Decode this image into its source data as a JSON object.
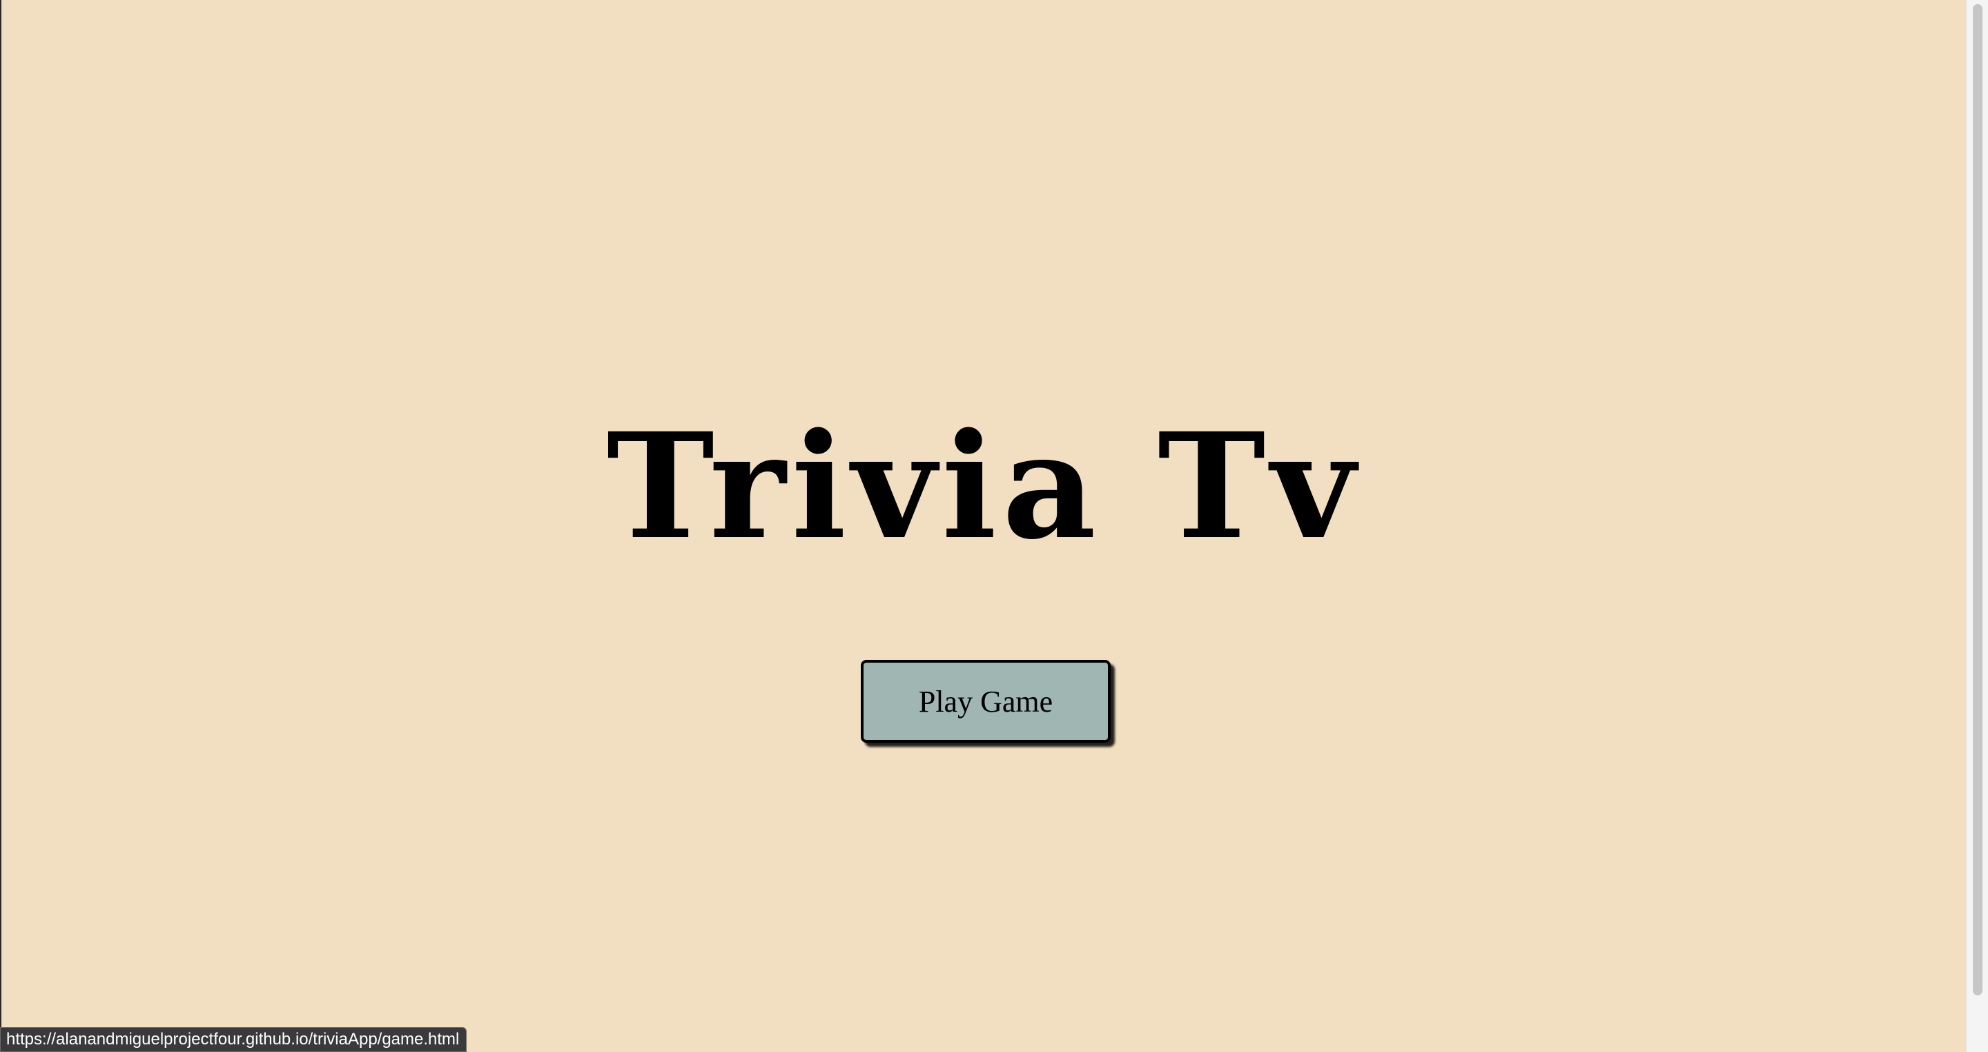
{
  "page": {
    "title": "Trivia Tv",
    "play_button_label": "Play Game"
  },
  "status_bar": {
    "url": "https://alanandmiguelprojectfour.github.io/triviaApp/game.html"
  },
  "colors": {
    "background": "#f2dec1",
    "button": "#9fb6b3",
    "text": "#000000"
  }
}
